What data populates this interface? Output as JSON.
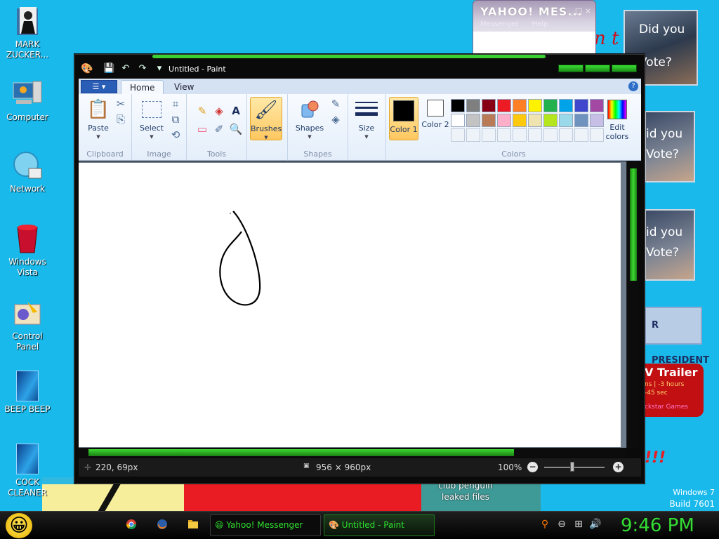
{
  "desktop": {
    "icons": [
      {
        "label": "MARK ZUCKER...",
        "icon": "folder-person-icon"
      },
      {
        "label": "Computer",
        "icon": "computer-icon"
      },
      {
        "label": "Network",
        "icon": "network-icon"
      },
      {
        "label": "Windows Vista",
        "icon": "recycle-bin-icon"
      },
      {
        "label": "Control Panel",
        "icon": "control-panel-icon"
      },
      {
        "label": "BEEP BEEP",
        "icon": "beep-file-icon"
      },
      {
        "label": "COCK CLEANER",
        "icon": "beep-file-icon"
      }
    ],
    "wallpaper_text": {
      "club_line1": "club penguin",
      "club_line2": "leaked files",
      "build_line1": "Windows 7",
      "build_line2": "Build 7601"
    },
    "side_cards": {
      "obama_line1": "Did you",
      "obama_line2": "Vote?",
      "card2_line1": "id you",
      "card2_line2": "Vote?",
      "card3_line1": "id you",
      "card3_line2": "Vote?",
      "president": "R PRESIDENT",
      "trailer_title": "V Trailer",
      "trailer_line1": "ns | -3 hours",
      "trailer_line2": "-45 sec",
      "trailer_line3": "ckstar Games",
      "bang": "!!!",
      "red_n": "n t"
    }
  },
  "yahoo": {
    "title": "YAHOO! MES...",
    "menu": [
      "Messenger",
      "Help"
    ],
    "controls": "_ □ ×"
  },
  "paint": {
    "title": "Untitled - Paint",
    "tabs": {
      "file": "☰ ▾",
      "home": "Home",
      "view": "View"
    },
    "groups": {
      "clipboard": {
        "label": "Clipboard",
        "paste": "Paste"
      },
      "image": {
        "label": "Image",
        "select": "Select"
      },
      "tools": {
        "label": "Tools"
      },
      "brushes": {
        "label": "Brushes"
      },
      "shapes": {
        "label": "Shapes",
        "shapes_btn": "Shapes"
      },
      "size": {
        "label": "Size"
      },
      "colors": {
        "label": "Colors",
        "color1": "Color 1",
        "color2": "Color 2",
        "edit": "Edit colors",
        "color1_value": "#000000",
        "color2_value": "#ffffff",
        "palette": [
          "#000000",
          "#7f7f7f",
          "#880015",
          "#ed1c24",
          "#ff7f27",
          "#fff200",
          "#22b14c",
          "#00a2e8",
          "#3f48cc",
          "#a349a4",
          "#ffffff",
          "#c3c3c3",
          "#b97a57",
          "#ffaec9",
          "#ffc90e",
          "#efe4b0",
          "#b5e61d",
          "#99d9ea",
          "#7092be",
          "#c8bfe7"
        ]
      }
    },
    "status": {
      "cursor_pos": "220, 69px",
      "canvas_size": "956 × 960px",
      "zoom": "100%"
    }
  },
  "taskbar": {
    "tasks": [
      {
        "label": "Yahoo! Messenger",
        "icon": "yahoo-smiley-icon"
      },
      {
        "label": "Untitled - Paint",
        "icon": "paint-icon"
      }
    ],
    "clock": "9:46 PM"
  },
  "colors": {
    "accent_green": "#33dd33",
    "desktop_blue": "#19b9ec",
    "ribbon_blue": "#d4e2f4"
  }
}
